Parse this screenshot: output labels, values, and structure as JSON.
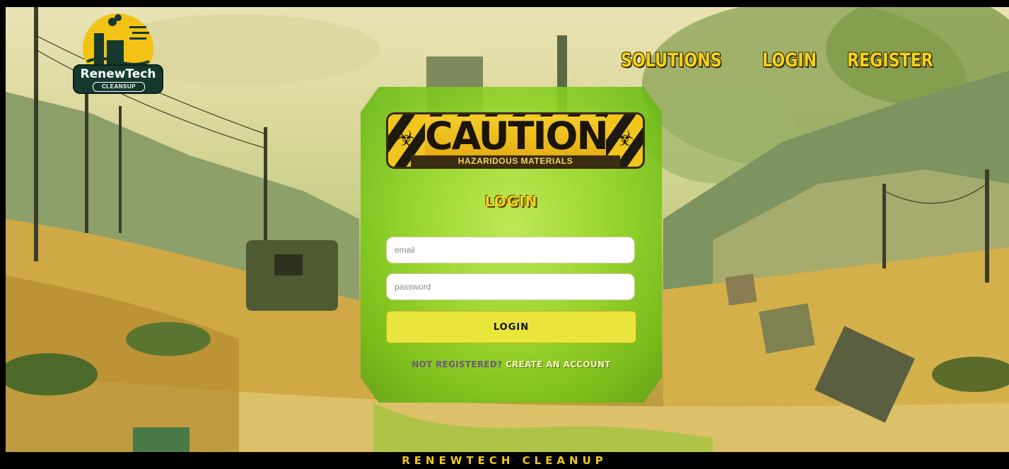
{
  "brand": {
    "name": "RenewTech",
    "tagline": "CLEANSUP"
  },
  "nav": {
    "items": [
      "SOLUTIONS",
      "LOGIN",
      "REGISTER"
    ]
  },
  "sign": {
    "title": "CAUTION",
    "subtitle": "HAZARIDOUS MATERIALS",
    "icon": "biohazard-icon"
  },
  "form": {
    "title": "LOGIN",
    "email_placeholder": "email",
    "password_placeholder": "password",
    "submit_label": "LOGIN",
    "register_prompt": "NOT REGISTERED?",
    "register_link": "CREATE AN ACCOUNT"
  },
  "footer": {
    "text": "RENEWTECH CLEANUP"
  },
  "colors": {
    "accent": "#f3d21d",
    "panel": "#9ed838",
    "button": "#eae53d",
    "footer_bg": "#000000"
  }
}
